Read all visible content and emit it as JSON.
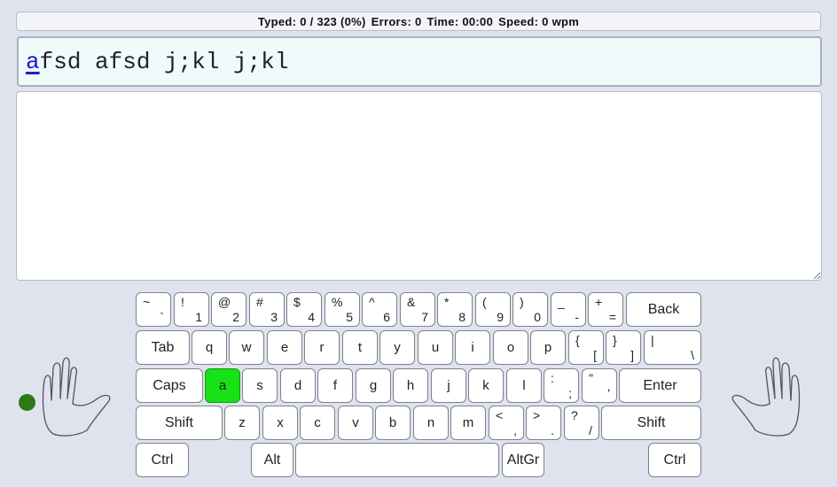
{
  "stats": {
    "typed_label": "Typed: 0 / 323 (0%)",
    "errors_label": "Errors: 0",
    "time_label": "Time: 00:00",
    "speed_label": "Speed: 0 wpm"
  },
  "prompt": {
    "current_char": "a",
    "rest": "fsd afsd j;kl j;kl"
  },
  "typing_area": {
    "value": ""
  },
  "keyboard": {
    "row1": [
      {
        "up": "~",
        "dn": "`"
      },
      {
        "up": "!",
        "dn": "1"
      },
      {
        "up": "@",
        "dn": "2"
      },
      {
        "up": "#",
        "dn": "3"
      },
      {
        "up": "$",
        "dn": "4"
      },
      {
        "up": "%",
        "dn": "5"
      },
      {
        "up": "^",
        "dn": "6"
      },
      {
        "up": "&",
        "dn": "7"
      },
      {
        "up": "*",
        "dn": "8"
      },
      {
        "up": "(",
        "dn": "9"
      },
      {
        "up": ")",
        "dn": "0"
      },
      {
        "up": "_",
        "dn": "-"
      },
      {
        "up": "+",
        "dn": "="
      }
    ],
    "back": "Back",
    "tab": "Tab",
    "row2": [
      "q",
      "w",
      "e",
      "r",
      "t",
      "y",
      "u",
      "i",
      "o",
      "p"
    ],
    "row2_sym": [
      {
        "up": "{",
        "dn": "["
      },
      {
        "up": "}",
        "dn": "]"
      },
      {
        "up": "|",
        "dn": "\\"
      }
    ],
    "caps": "Caps",
    "row3": [
      "a",
      "s",
      "d",
      "f",
      "g",
      "h",
      "j",
      "k",
      "l"
    ],
    "row3_sym": [
      {
        "up": ":",
        "dn": ";"
      },
      {
        "up": "\"",
        "dn": "'"
      }
    ],
    "enter": "Enter",
    "shift_left": "Shift",
    "row4": [
      "z",
      "x",
      "c",
      "v",
      "b",
      "n",
      "m"
    ],
    "row4_sym": [
      {
        "up": "<",
        "dn": ","
      },
      {
        "up": ">",
        "dn": "."
      },
      {
        "up": "?",
        "dn": "/"
      }
    ],
    "shift_right": "Shift",
    "ctrl_left": "Ctrl",
    "alt": "Alt",
    "space": "",
    "altgr": "AltGr",
    "ctrl_right": "Ctrl",
    "active_key": "a",
    "active_color": "#17e117"
  },
  "hands": {
    "left_icon": "left-hand-outline-icon",
    "right_icon": "right-hand-outline-icon",
    "finger_dot_color": "#2c7a16"
  }
}
